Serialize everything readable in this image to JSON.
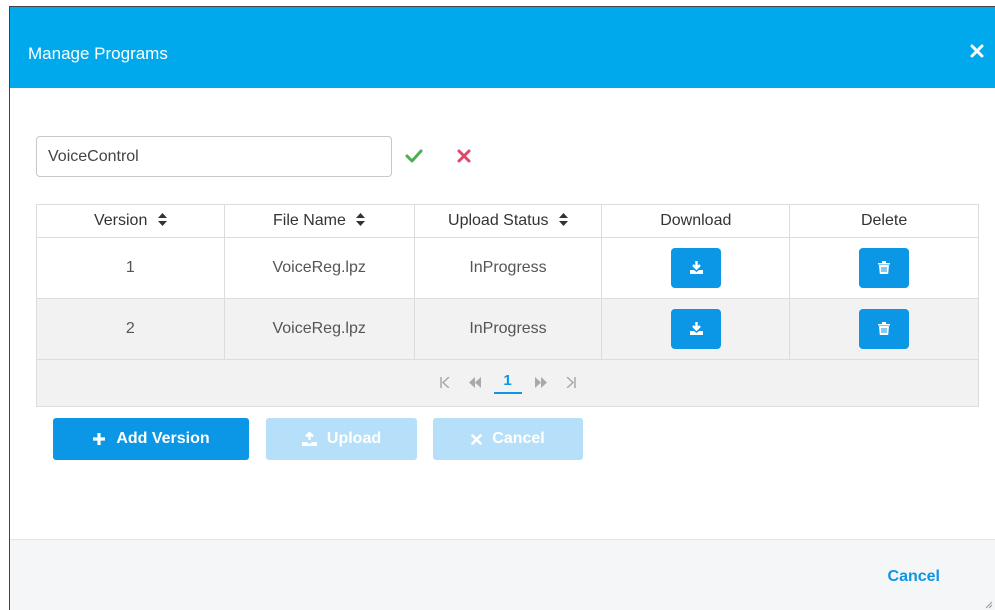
{
  "dialog": {
    "title": "Manage Programs",
    "close_icon": "close-icon"
  },
  "program_name": {
    "value": "VoiceControl",
    "confirm_icon": "checkmark-icon",
    "cancel_icon": "x-icon"
  },
  "table": {
    "columns": [
      "Version",
      "File Name",
      "Upload Status",
      "Download",
      "Delete"
    ],
    "rows": [
      {
        "version": "1",
        "file_name": "VoiceReg.lpz",
        "upload_status": "InProgress"
      },
      {
        "version": "2",
        "file_name": "VoiceReg.lpz",
        "upload_status": "InProgress"
      }
    ],
    "pagination": {
      "current_page": "1"
    }
  },
  "actions": {
    "add_version": "Add Version",
    "upload": "Upload",
    "cancel": "Cancel"
  },
  "footer": {
    "cancel": "Cancel"
  },
  "colors": {
    "header": "#00a9ec",
    "primary": "#0b96e6",
    "disabled": "#b6e0fa",
    "confirm": "#4caf50",
    "reject": "#e0486a"
  }
}
